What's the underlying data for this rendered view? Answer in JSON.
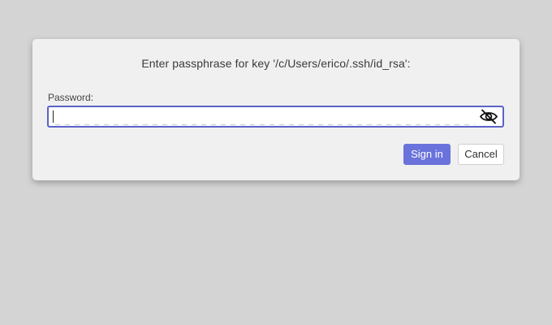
{
  "dialog": {
    "prompt": "Enter passphrase for key '/c/Users/erico/.ssh/id_rsa':",
    "field_label": "Password:",
    "password_value": "",
    "toggle_icon": "eye-slash-icon",
    "sign_in_label": "Sign in",
    "cancel_label": "Cancel"
  },
  "colors": {
    "backdrop": "#d4d4d4",
    "dialog_bg": "#f0f0f0",
    "accent": "#6a73db",
    "focus_border": "#5b63c9"
  }
}
